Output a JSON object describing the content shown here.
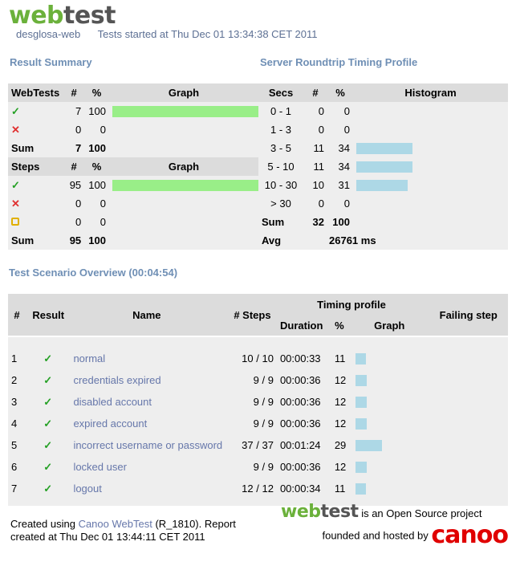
{
  "header": {
    "logo_w": "web",
    "logo_t": "test",
    "project": "desglosa-web",
    "started": "Tests started at Thu Dec 01 13:34:38 CET 2011"
  },
  "result_summary": {
    "title": "Result Summary",
    "webtests_head": [
      "WebTests",
      "#",
      "%",
      "Graph"
    ],
    "webtests_rows": [
      {
        "icon": "check-icon",
        "count": "7",
        "pct": "100",
        "fill": 1.0
      },
      {
        "icon": "cross-icon",
        "count": "0",
        "pct": "0",
        "fill": 0
      }
    ],
    "webtests_sum": {
      "label": "Sum",
      "count": "7",
      "pct": "100"
    },
    "steps_head": [
      "Steps",
      "#",
      "%",
      "Graph"
    ],
    "steps_rows": [
      {
        "icon": "check-icon",
        "count": "95",
        "pct": "100",
        "fill": 1.0
      },
      {
        "icon": "cross-icon",
        "count": "0",
        "pct": "0",
        "fill": 0
      },
      {
        "icon": "skipped-icon",
        "count": "0",
        "pct": "0",
        "fill": 0
      }
    ],
    "steps_sum": {
      "label": "Sum",
      "count": "95",
      "pct": "100"
    }
  },
  "timing_profile": {
    "title": "Server Roundtrip Timing Profile",
    "head": [
      "Secs",
      "#",
      "%",
      "Histogram"
    ],
    "rows": [
      {
        "secs": "0 - 1",
        "count": "0",
        "pct": "0",
        "fill": 0
      },
      {
        "secs": "1 - 3",
        "count": "0",
        "pct": "0",
        "fill": 0
      },
      {
        "secs": "3 - 5",
        "count": "11",
        "pct": "34",
        "fill": 0.34
      },
      {
        "secs": "5 - 10",
        "count": "11",
        "pct": "34",
        "fill": 0.34
      },
      {
        "secs": "10 - 30",
        "count": "10",
        "pct": "31",
        "fill": 0.31
      },
      {
        "secs": "> 30",
        "count": "0",
        "pct": "0",
        "fill": 0
      }
    ],
    "sum": {
      "label": "Sum",
      "count": "32",
      "pct": "100"
    },
    "avg": {
      "label": "Avg",
      "value": "26761 ms"
    }
  },
  "overview": {
    "title": "Test Scenario Overview (00:04:54)",
    "head": {
      "num": "#",
      "result": "Result",
      "name": "Name",
      "steps": "# Steps",
      "timing": "Timing profile",
      "duration": "Duration",
      "pct": "%",
      "graph": "Graph",
      "failing": "Failing step"
    },
    "rows": [
      {
        "num": "1",
        "name": "normal",
        "steps": "10 / 10",
        "duration": "00:00:33",
        "pct": "11",
        "fill": 0.11
      },
      {
        "num": "2",
        "name": "credentials expired",
        "steps": "9 / 9",
        "duration": "00:00:36",
        "pct": "12",
        "fill": 0.12
      },
      {
        "num": "3",
        "name": "disabled account",
        "steps": "9 / 9",
        "duration": "00:00:36",
        "pct": "12",
        "fill": 0.12
      },
      {
        "num": "4",
        "name": "expired account",
        "steps": "9 / 9",
        "duration": "00:00:36",
        "pct": "12",
        "fill": 0.12
      },
      {
        "num": "5",
        "name": "incorrect username or password",
        "steps": "37 / 37",
        "duration": "00:01:24",
        "pct": "29",
        "fill": 0.29
      },
      {
        "num": "6",
        "name": "locked user",
        "steps": "9 / 9",
        "duration": "00:00:36",
        "pct": "12",
        "fill": 0.12
      },
      {
        "num": "7",
        "name": "logout",
        "steps": "12 / 12",
        "duration": "00:00:34",
        "pct": "11",
        "fill": 0.11
      }
    ]
  },
  "footer": {
    "created_prefix": "Created using ",
    "created_link": "Canoo WebTest",
    "created_suffix": " (R_1810). Report",
    "created_at": "created at Thu Dec 01 13:44:11 CET 2011",
    "oss_text": "is an Open Source project",
    "founded_text": "founded and hosted by",
    "canoo": "canoo"
  },
  "colors": {
    "ok": "#24a024",
    "fail": "#e03030",
    "green_bar": "#99ee88",
    "blue_bar": "#add8e6",
    "title": "#6f8fb5"
  }
}
